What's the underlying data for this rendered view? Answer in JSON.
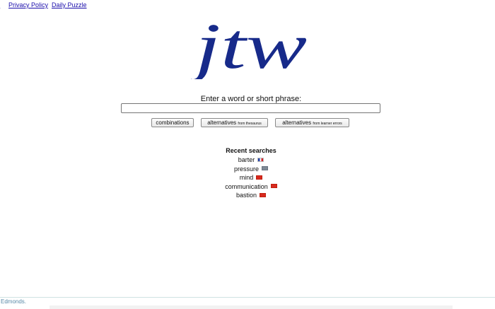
{
  "nav": {
    "partial_label": "",
    "privacy_label": "Privacy Policy",
    "puzzle_label": "Daily Puzzle"
  },
  "logo": {
    "text": "jtw",
    "color": "#172a8a"
  },
  "search": {
    "prompt": "Enter a word or short phrase:",
    "value": "",
    "placeholder": ""
  },
  "buttons": {
    "combinations": "combinations",
    "thesaurus_main": "alternatives",
    "thesaurus_sub": "from thesaurus",
    "learner_main": "alternatives",
    "learner_sub": "from learner errors"
  },
  "recent": {
    "title": "Recent searches",
    "items": [
      {
        "word": "barter",
        "flag": "flag-france-icon"
      },
      {
        "word": "pressure",
        "flag": "flag-greece-icon"
      },
      {
        "word": "mind",
        "flag": "flag-china-icon"
      },
      {
        "word": "communication",
        "flag": "flag-china-icon"
      },
      {
        "word": "bastion",
        "flag": "flag-china-icon"
      }
    ]
  },
  "footer": {
    "text": "Edmonds."
  }
}
